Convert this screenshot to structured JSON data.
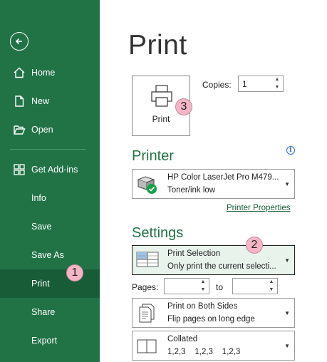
{
  "sidebar": {
    "items": [
      {
        "label": "Home",
        "icon": "home-icon"
      },
      {
        "label": "New",
        "icon": "new-document-icon"
      },
      {
        "label": "Open",
        "icon": "folder-open-icon"
      },
      {
        "label": "Get Add-ins",
        "icon": "add-ins-grid-icon"
      },
      {
        "label": "Info"
      },
      {
        "label": "Save"
      },
      {
        "label": "Save As"
      },
      {
        "label": "Print"
      },
      {
        "label": "Share"
      },
      {
        "label": "Export"
      }
    ],
    "active": "Print"
  },
  "callouts": [
    "1",
    "2",
    "3"
  ],
  "main": {
    "title": "Print",
    "print_button": "Print",
    "copies": {
      "label": "Copies:",
      "value": "1"
    },
    "printer": {
      "heading": "Printer",
      "name": "HP Color LaserJet Pro M479...",
      "status": "Toner/ink low",
      "properties_link": "Printer Properties"
    },
    "settings": {
      "heading": "Settings",
      "scope": {
        "title": "Print Selection",
        "subtitle": "Only print the current selecti..."
      },
      "pages_label": "Pages:",
      "pages_from": "",
      "to_label": "to",
      "pages_to": "",
      "sides": {
        "title": "Print on Both Sides",
        "subtitle": "Flip pages on long edge"
      },
      "collation": {
        "title": "Collated",
        "subtitle": "1,2,3    1,2,3    1,2,3"
      }
    }
  },
  "colors": {
    "accent": "#217346",
    "active_nav": "#185c37",
    "callout": "#f4b6c6"
  }
}
